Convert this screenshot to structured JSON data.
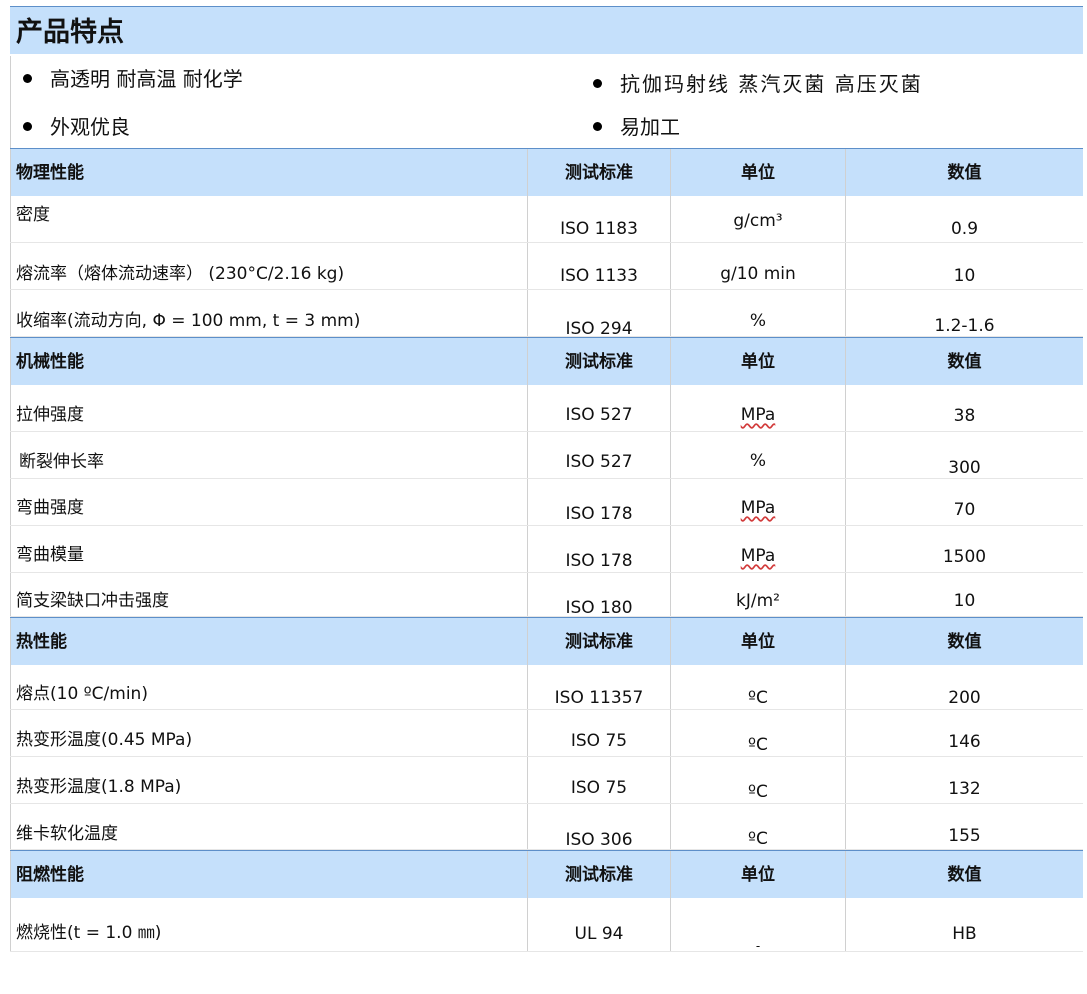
{
  "title": "产品特点",
  "features": [
    "高透明 耐高温 耐化学",
    "抗伽玛射线 蒸汽灭菌 高压灭菌",
    "外观优良",
    "易加工"
  ],
  "columns": {
    "standard": "测试标准",
    "unit": "单位",
    "value": "数值"
  },
  "sections": [
    {
      "name": "物理性能",
      "rows": [
        {
          "property": "密度",
          "standard": "ISO 1183",
          "unit": "g/cm³",
          "value": "0.9"
        },
        {
          "property": "熔流率（熔体流动速率） (230°C/2.16 kg)",
          "standard": "ISO 1133",
          "unit": "g/10 min",
          "value": "10"
        },
        {
          "property": "收缩率(流动方向, Φ = 100 mm, t = 3 mm)",
          "standard": "ISO 294",
          "unit": "%",
          "value": "1.2-1.6"
        }
      ]
    },
    {
      "name": "机械性能",
      "rows": [
        {
          "property": "拉伸强度",
          "standard": "ISO 527",
          "unit": "MPa",
          "value": "38"
        },
        {
          "property": "断裂伸长率",
          "standard": "ISO 527",
          "unit": "%",
          "value": "300"
        },
        {
          "property": "弯曲强度",
          "standard": "ISO 178",
          "unit": "MPa",
          "value": "70"
        },
        {
          "property": "弯曲模量",
          "standard": "ISO 178",
          "unit": "MPa",
          "value": "1500"
        },
        {
          "property": "简支梁缺口冲击强度",
          "standard": "ISO 180",
          "unit": "kJ/m²",
          "value": "10"
        }
      ]
    },
    {
      "name": "热性能",
      "rows": [
        {
          "property": "熔点(10 ºC/min)",
          "standard": "ISO 11357",
          "unit": "ºC",
          "value": "200"
        },
        {
          "property": "热变形温度(0.45 MPa)",
          "standard": "ISO 75",
          "unit": "ºC",
          "value": "146"
        },
        {
          "property": "热变形温度(1.8 MPa)",
          "standard": "ISO 75",
          "unit": "ºC",
          "value": "132"
        },
        {
          "property": "维卡软化温度",
          "standard": "ISO 306",
          "unit": "ºC",
          "value": "155"
        }
      ]
    },
    {
      "name": "阻燃性能",
      "rows": [
        {
          "property": "燃烧性(t = 1.0 ㎜)",
          "standard": "UL 94",
          "unit": "-",
          "value": "HB"
        }
      ]
    }
  ]
}
